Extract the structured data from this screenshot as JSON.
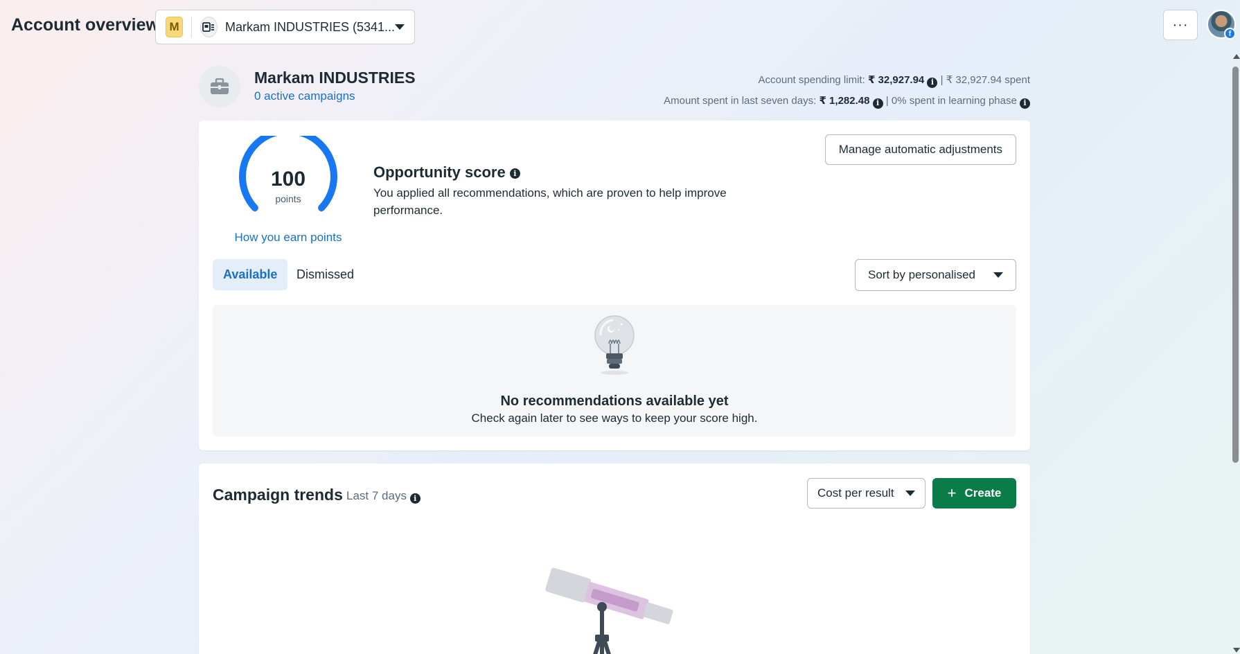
{
  "header": {
    "title": "Account overview",
    "account_badge": "M",
    "account_name": "Markam INDUSTRIES (5341...",
    "more_label": "···"
  },
  "account": {
    "name": "Markam INDUSTRIES",
    "active_campaigns": "0 active campaigns",
    "spending_limit_label": "Account spending limit:",
    "spending_limit_value": "₹ 32,927.94",
    "spent_value": "| ₹ 32,927.94 spent",
    "seven_days_label": "Amount spent in last seven days:",
    "seven_days_value": "₹ 1,282.48",
    "learning_phase": "| 0% spent in learning phase"
  },
  "opportunity": {
    "score": "100",
    "score_value": 100,
    "score_max": 100,
    "points_label": "points",
    "earn_link": "How you earn points",
    "title": "Opportunity score",
    "description": "You applied all recommendations, which are proven to help improve performance.",
    "manage_button": "Manage automatic adjustments",
    "tabs": [
      {
        "label": "Available",
        "active": true
      },
      {
        "label": "Dismissed",
        "active": false
      }
    ],
    "sort_label": "Sort by personalised",
    "empty_title": "No recommendations available yet",
    "empty_subtitle": "Check again later to see ways to keep your score high."
  },
  "trends": {
    "title": "Campaign trends",
    "period": "Last 7 days",
    "metric_select": "Cost per result",
    "create_label": "Create"
  },
  "colors": {
    "accent_blue": "#1877f2",
    "link_blue": "#1a6fc9",
    "create_green": "#0a7c48",
    "badge_yellow": "#f7d97a"
  }
}
